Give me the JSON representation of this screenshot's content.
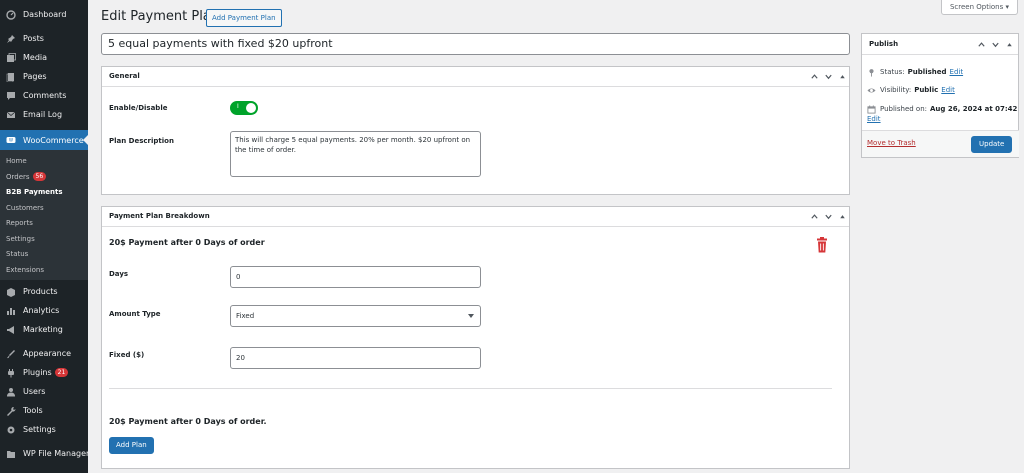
{
  "sidebar": {
    "items": [
      {
        "label": "Dashboard",
        "icon": "dashboard-icon"
      },
      {
        "label": "Posts",
        "icon": "pin-icon"
      },
      {
        "label": "Media",
        "icon": "media-icon"
      },
      {
        "label": "Pages",
        "icon": "pages-icon"
      },
      {
        "label": "Comments",
        "icon": "comments-icon"
      },
      {
        "label": "Email Log",
        "icon": "email-icon"
      },
      {
        "label": "WooCommerce",
        "icon": "woo-icon"
      },
      {
        "label": "Products",
        "icon": "products-icon"
      },
      {
        "label": "Analytics",
        "icon": "analytics-icon"
      },
      {
        "label": "Marketing",
        "icon": "marketing-icon"
      },
      {
        "label": "Appearance",
        "icon": "appearance-icon"
      },
      {
        "label": "Plugins",
        "icon": "plugins-icon",
        "badge": "21"
      },
      {
        "label": "Users",
        "icon": "users-icon"
      },
      {
        "label": "Tools",
        "icon": "tools-icon"
      },
      {
        "label": "Settings",
        "icon": "settings-icon"
      },
      {
        "label": "WP File Manager",
        "icon": "file-manager-icon"
      }
    ],
    "submenu": [
      {
        "label": "Home"
      },
      {
        "label": "Orders",
        "badge": "56"
      },
      {
        "label": "B2B Payments"
      },
      {
        "label": "Customers"
      },
      {
        "label": "Reports"
      },
      {
        "label": "Settings"
      },
      {
        "label": "Status"
      },
      {
        "label": "Extensions"
      }
    ]
  },
  "header": {
    "title": "Edit Payment Plan",
    "add_button": "Add Payment Plan",
    "screen_options": "Screen Options ▾"
  },
  "post_title": "5 equal payments with fixed $20 upfront",
  "general": {
    "title": "General",
    "enable_label": "Enable/Disable",
    "toggle_on": true,
    "toggle_mark": "I",
    "description_label": "Plan Description",
    "description": "This will charge 5 equal payments. 20% per month. $20 upfront on the time of order."
  },
  "breakdown": {
    "title": "Payment Plan Breakdown",
    "item_heading": "20$ Payment after 0 Days of order",
    "days_label": "Days",
    "days_value": "0",
    "amount_type_label": "Amount Type",
    "amount_type_value": "Fixed",
    "fixed_label": "Fixed ($)",
    "fixed_value": "20",
    "summary": "20$ Payment after 0 Days of order.",
    "add_plan": "Add Plan"
  },
  "publish": {
    "title": "Publish",
    "status_label": "Status:",
    "status_value": "Published",
    "visibility_label": "Visibility:",
    "visibility_value": "Public",
    "published_label": "Published on:",
    "published_value": "Aug 26, 2024 at 07:42",
    "edit": "Edit",
    "move_to_trash": "Move to Trash",
    "update": "Update"
  },
  "colors": {
    "sidebar_bg": "#1d2327",
    "accent": "#2271b1",
    "toggle_on": "#00a32a",
    "danger": "#d63638"
  }
}
